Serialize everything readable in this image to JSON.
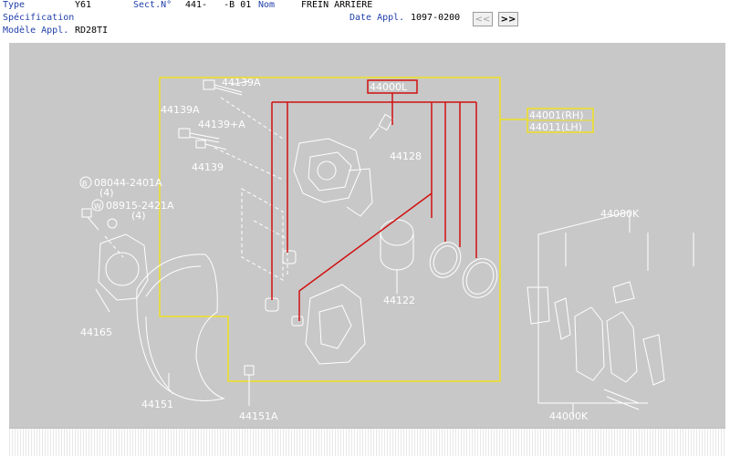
{
  "header": {
    "type_label": "Type",
    "type_value": "Y61",
    "sect_label": "Sect.N°",
    "sect_value": "441-   -B 01",
    "nom_label": "Nom",
    "nom_value": "FREIN ARRIÈRE",
    "spec_label": "Spécification",
    "date_label": "Date Appl.",
    "date_value": "1097-0200",
    "model_label": "Modèle Appl.",
    "model_value": "RD28TI",
    "prev_button": "<<",
    "next_button": ">>"
  },
  "diagram": {
    "colors": {
      "background": "#c8c8c8",
      "line": "#ffffff",
      "highlight_red": "#d01010",
      "highlight_yellow": "#f0e020"
    },
    "parts": {
      "p44139a_top": "44139A",
      "p44139a_left": "44139A",
      "p44139pa": "44139+A",
      "p44139": "44139",
      "p08044": "08044-2401A",
      "p08044_qty": "(4)",
      "p08044_prefix": "B",
      "p08915": "08915-2421A",
      "p08915_qty": "(4)",
      "p08915_prefix": "W",
      "p44000l": "44000L",
      "p44001": "44001(RH)",
      "p44011": "44011(LH)",
      "p44128": "44128",
      "p44122": "44122",
      "p44165": "44165",
      "p44151": "44151",
      "p44151a": "44151A",
      "p44080k": "44080K",
      "p44000k": "44000K"
    }
  }
}
